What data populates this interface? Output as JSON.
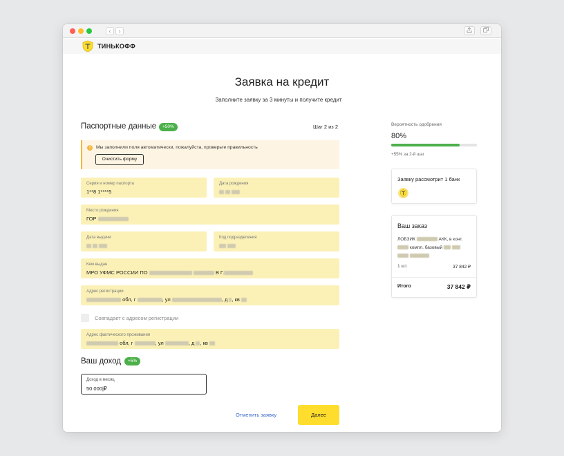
{
  "browser": {
    "back": "‹",
    "forward": "›",
    "share_icon": "share-icon",
    "tabs_icon": "tabs-icon"
  },
  "header": {
    "logo_text": "ТИНЬКОФФ"
  },
  "page": {
    "title": "Заявка на кредит",
    "subtitle": "Заполните заявку за 3 минуты и получите кредит"
  },
  "passport": {
    "title": "Паспортные данные",
    "badge": "+50%",
    "step": "Шаг 2 из 2",
    "notice": "Мы заполнили поля автоматически, пожалуйста, проверьте правильность",
    "clear_button": "Очистить форму",
    "fields": {
      "series_label": "Серия и номер паспорта",
      "series_value": "1**8 1****5",
      "birthdate_label": "Дата рождения",
      "birthdate_value": "",
      "birthplace_label": "Место рождения",
      "birthplace_value": "ГОР",
      "issue_date_label": "Дата выдачи",
      "issue_date_value": "",
      "dept_code_label": "Код подразделения",
      "dept_code_value": "",
      "issued_by_label": "Кем выдан",
      "issued_by_prefix": "МРО УФМС РОССИИ ПО",
      "issued_by_mid": "В Г.",
      "reg_address_label": "Адрес регистрации",
      "reg_obl": "обл, г",
      "reg_ul": ", ул",
      "reg_d": ", д",
      "reg_kv": ", кв",
      "same_address_label": "Совпадает с адресом регистрации",
      "actual_address_label": "Адрес фактического проживания",
      "act_obl": "обл, г",
      "act_ul": ", ул",
      "act_d": ", д",
      "act_kv": ", кв"
    }
  },
  "income": {
    "title": "Ваш доход",
    "badge": "+5%",
    "field_label": "Доход в месяц",
    "field_value": "50 000|₽"
  },
  "actions": {
    "cancel": "Отменить заявку",
    "next": "Далее"
  },
  "sidebar": {
    "probability_label": "Вероятность одобрения",
    "probability_value": "80%",
    "probability_fraction": 0.8,
    "probability_note": "+55% за 2-й шаг",
    "bank_card_title": "Заявку рассмотрит 1 банк",
    "order_title": "Ваш заказ",
    "order_item_line1": "ЛОБЗИК",
    "order_item_line1b": "АКК, в конт.",
    "order_item_line2": "компл. базовый",
    "qty": "1 шт.",
    "price": "37 842 ₽",
    "total_label": "Итого",
    "total_value": "37 842 ₽"
  },
  "colors": {
    "accent_yellow": "#ffdd2d",
    "field_bg": "#fbf1b7",
    "badge_green": "#4cb04a",
    "link_blue": "#3a68c9"
  }
}
